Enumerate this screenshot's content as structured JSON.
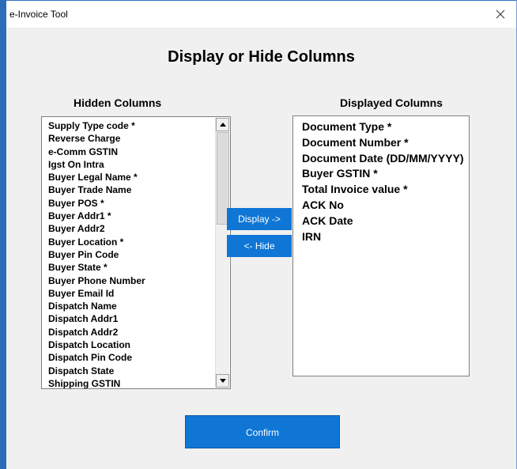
{
  "window": {
    "title": "e-Invoice Tool"
  },
  "dialog": {
    "heading": "Display or Hide Columns",
    "hidden_label": "Hidden Columns",
    "displayed_label": "Displayed Columns",
    "hidden_columns": [
      "Supply Type code *",
      "Reverse Charge",
      "e-Comm GSTIN",
      "Igst On Intra",
      "Buyer Legal Name *",
      "Buyer Trade Name",
      "Buyer POS *",
      "Buyer Addr1 *",
      "Buyer Addr2",
      "Buyer Location *",
      "Buyer Pin Code",
      "Buyer State *",
      "Buyer Phone Number",
      "Buyer Email Id",
      "Dispatch Name",
      "Dispatch Addr1",
      "Dispatch Addr2",
      "Dispatch Location",
      "Dispatch Pin Code",
      "Dispatch State",
      "Shipping GSTIN"
    ],
    "displayed_columns": [
      "Document Type *",
      "Document Number *",
      "Document Date (DD/MM/YYYY)",
      "Buyer GSTIN *",
      "Total Invoice value *",
      "ACK No",
      "ACK Date",
      "IRN"
    ],
    "display_button": "Display ->",
    "hide_button": "<-  Hide",
    "confirm_button": "Confirm"
  },
  "icons": {
    "close": "close-icon",
    "scroll_up": "arrow-up-icon",
    "scroll_down": "arrow-down-icon"
  },
  "colors": {
    "button_blue": "#0f76d6",
    "window_accent": "#2b6db8"
  }
}
